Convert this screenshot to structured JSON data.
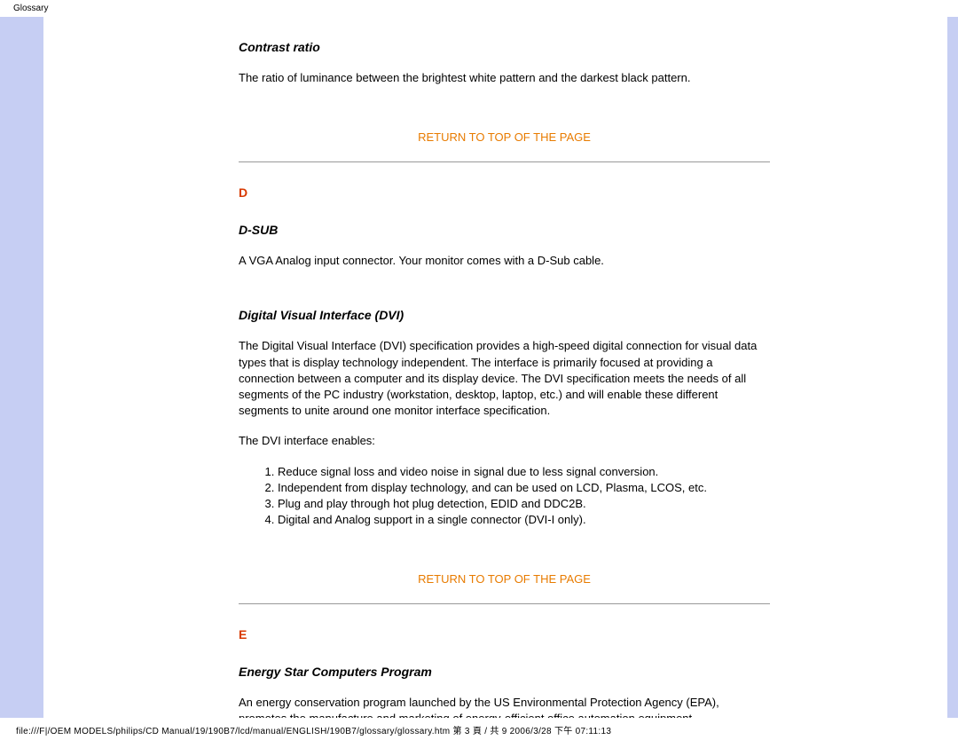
{
  "header": {
    "label": "Glossary"
  },
  "content": {
    "contrast_ratio": {
      "title": "Contrast ratio",
      "body": "The ratio of luminance between the brightest white pattern and the darkest black pattern."
    },
    "return_link": "RETURN TO TOP OF THE PAGE",
    "section_d": {
      "letter": "D",
      "dsub": {
        "title": "D-SUB",
        "body": "A VGA Analog input connector. Your monitor comes with a D-Sub cable."
      },
      "dvi": {
        "title": "Digital Visual Interface (DVI)",
        "body1": "The Digital Visual Interface (DVI) specification provides a high-speed digital connection for visual data types that is display technology independent. The interface is primarily focused at providing a connection between a computer and its display device. The DVI specification meets the needs of all segments of the PC industry (workstation, desktop, laptop, etc.) and will enable these different segments to unite around one monitor interface specification.",
        "body2": "The DVI interface enables:",
        "list": [
          "Reduce signal loss and video noise in signal due to less signal conversion.",
          "Independent from display technology, and can be used on LCD, Plasma, LCOS, etc.",
          "Plug and play through hot plug detection, EDID and DDC2B.",
          "Digital and Analog support in a single connector (DVI-I only)."
        ]
      }
    },
    "section_e": {
      "letter": "E",
      "energy_star": {
        "title": "Energy Star Computers Program",
        "body": "An energy conservation program launched by the US Environmental Protection Agency (EPA), promotes the manufacture and marketing of energy-efficient office automation equipment."
      }
    }
  },
  "footer": {
    "path": "file:///F|/OEM MODELS/philips/CD Manual/19/190B7/lcd/manual/ENGLISH/190B7/glossary/glossary.htm 第 3 頁 / 共 9 2006/3/28 下午 07:11:13"
  }
}
